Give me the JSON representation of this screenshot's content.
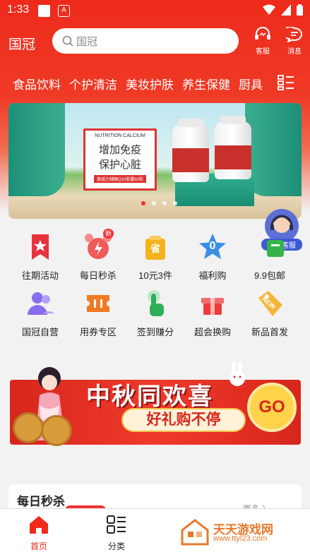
{
  "status_bar": {
    "time": "1:33",
    "app_icon_letter": "A"
  },
  "header": {
    "brand": "国冠",
    "search_placeholder": "国冠",
    "service_label": "客服",
    "message_label": "消息"
  },
  "categories": [
    "食品饮料",
    "个护清洁",
    "美妆护肤",
    "养生保健",
    "厨具"
  ],
  "banner": {
    "card_en": "NUTRITION CALCIUM",
    "card_line1": "增加免疫",
    "card_line2": "保护心脏",
    "card_tag": "惠威力辅酶Q10胶囊60粒"
  },
  "customer_service": {
    "label": "联系客服"
  },
  "shortcuts": [
    {
      "label": "往期活动",
      "icon": "bookmark-star-icon",
      "color": "#e8323c"
    },
    {
      "label": "每日秒杀",
      "icon": "alarm-clock-icon",
      "color": "#f25a5a",
      "badge": "新"
    },
    {
      "label": "10元3件",
      "icon": "province-bag-icon",
      "color": "#f5b21b",
      "text": "省"
    },
    {
      "label": "福利购",
      "icon": "star-zero-icon",
      "color": "#3a8ee6",
      "text": "0"
    },
    {
      "label": "9.9包邮",
      "icon": "shipping-box-icon",
      "color": "#36b24a"
    },
    {
      "label": "国冠自营",
      "icon": "users-icon",
      "color": "#8a6cf0"
    },
    {
      "label": "用券专区",
      "icon": "coupon-ticket-icon",
      "color": "#f07a24"
    },
    {
      "label": "签到赚分",
      "icon": "tap-hand-icon",
      "color": "#2fae58"
    },
    {
      "label": "超会换购",
      "icon": "gift-box-icon",
      "color": "#ee3b3b"
    },
    {
      "label": "新品首发",
      "icon": "new-tag-icon",
      "color": "#f6b63a",
      "text": "NEW"
    }
  ],
  "promo": {
    "title": "中秋同欢喜",
    "subtitle": "好礼购不停",
    "go": "GO"
  },
  "seckill": {
    "title": "每日秒杀",
    "more": "更多 〉"
  },
  "tabbar": [
    {
      "label": "首页",
      "active": true
    },
    {
      "label": "分类",
      "active": false
    }
  ],
  "watermark": {
    "name": "天天游戏网",
    "url": "www.ttyl23.com"
  },
  "colors": {
    "primary": "#ee2a1b",
    "accent_orange": "#e9782b"
  }
}
